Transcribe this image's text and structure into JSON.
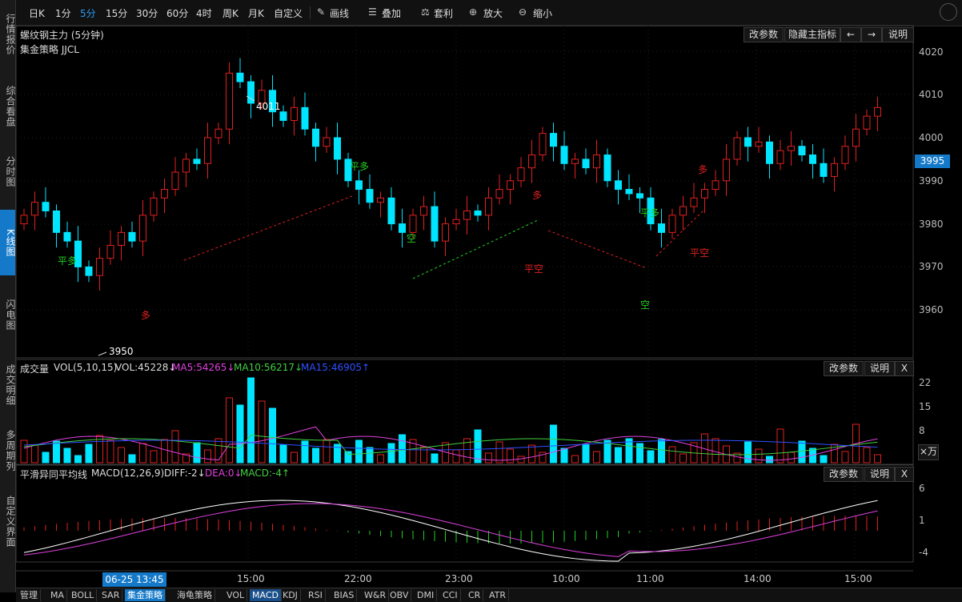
{
  "side_tabs": [
    "行情报价",
    "综合看盘",
    "分时图",
    "K线图",
    "闪电图",
    "成交明细",
    "多周期列",
    "自定义界面"
  ],
  "side_active": 3,
  "toolbar": {
    "periods": [
      "日K",
      "1分",
      "5分",
      "15分",
      "30分",
      "60分",
      "4时",
      "周K",
      "月K",
      "自定义"
    ],
    "active_period": 2,
    "tools": [
      "画线",
      "叠加",
      "套利",
      "放大",
      "缩小"
    ]
  },
  "main": {
    "title": "螺纹钢主力 (5分钟)",
    "strategy": "集金策略  JJCL",
    "buttons": [
      "改参数",
      "隐藏主指标",
      "←",
      "→",
      "说明"
    ],
    "price_axis": [
      "4020",
      "4010",
      "4000",
      "3990",
      "3980",
      "3970",
      "3960"
    ],
    "current_price": "3995",
    "high_label": "4011",
    "low_label": "3950",
    "signals": [
      {
        "text": "平多",
        "color": "#22d022"
      },
      {
        "text": "多",
        "color": "#e02020"
      },
      {
        "text": "平多",
        "color": "#22d022"
      },
      {
        "text": "空",
        "color": "#22d022"
      },
      {
        "text": "多",
        "color": "#e02020"
      },
      {
        "text": "平空",
        "color": "#e02020"
      },
      {
        "text": "平多",
        "color": "#22d022"
      },
      {
        "text": "空",
        "color": "#22d022"
      },
      {
        "text": "多",
        "color": "#e02020"
      },
      {
        "text": "平空",
        "color": "#e02020"
      }
    ]
  },
  "volume": {
    "title": "成交量",
    "params": "VOL(5,10,15)",
    "vol": "VOL:45228↓",
    "ma5": "MA5:54265↓",
    "ma10": "MA10:56217↓",
    "ma15": "MA15:46905↑",
    "axis": [
      "22",
      "15",
      "8"
    ],
    "unit": "×万",
    "buttons": [
      "改参数",
      "说明",
      "X"
    ]
  },
  "macd": {
    "title": "平滑异同平均线",
    "params": "MACD(12,26,9)",
    "diff": "DIFF:-2↓",
    "dea": "DEA:0↓",
    "macd": "MACD:-4↑",
    "axis": [
      "6",
      "1",
      "-4"
    ],
    "buttons": [
      "改参数",
      "说明",
      "X"
    ]
  },
  "time_axis": {
    "date_tag": "06-25 13:45",
    "labels": [
      "15:00",
      "22:00",
      "23:00",
      "10:00",
      "11:00",
      "14:00",
      "15:00"
    ]
  },
  "bottom_tabs": [
    "管理",
    "MA",
    "BOLL",
    "SAR",
    "集金策略",
    "海龟策略",
    "VOL",
    "MACD",
    "KDJ",
    "RSI",
    "BIAS",
    "W&R",
    "OBV",
    "DMI",
    "CCI",
    "CR",
    "ATR"
  ],
  "bottom_active": 4,
  "bottom_hl": 7,
  "colors": {
    "up": "#e02020",
    "down": "#00e5ff",
    "ma5": "#e040e0",
    "ma10": "#40d040",
    "ma15": "#3050ff",
    "diff": "#ffffff",
    "dea": "#e040e0"
  }
}
